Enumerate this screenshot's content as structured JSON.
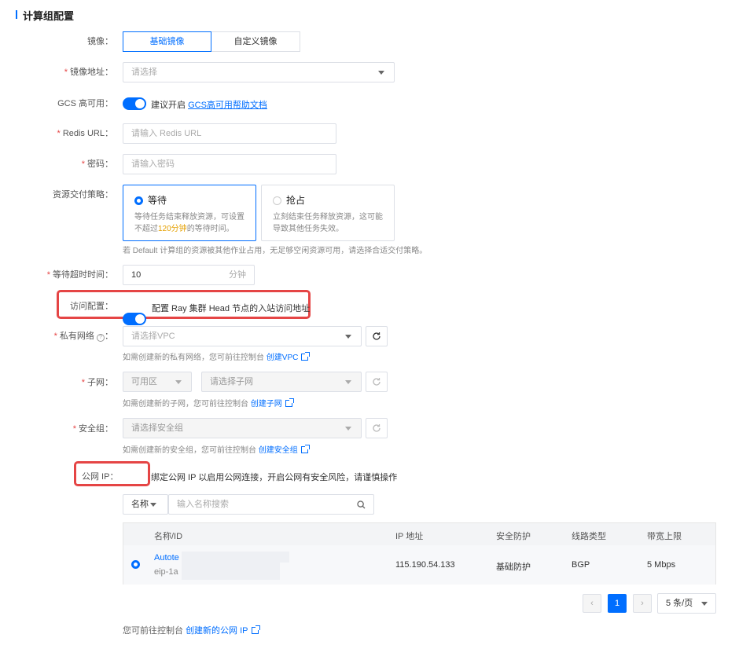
{
  "section_title": "计算组配置",
  "image": {
    "label": "镜像：",
    "options": [
      "基础镜像",
      "自定义镜像"
    ],
    "selected": "基础镜像"
  },
  "image_addr": {
    "label": "镜像地址：",
    "placeholder": "请选择"
  },
  "gcs": {
    "label": "GCS 高可用：",
    "text": "建议开启",
    "link": "GCS高可用帮助文档",
    "enabled": true
  },
  "redis": {
    "label": "Redis URL：",
    "placeholder": "请输入 Redis URL"
  },
  "password": {
    "label": "密码：",
    "placeholder": "请输入密码"
  },
  "strategy": {
    "label": "资源交付策略：",
    "wait": {
      "title": "等待",
      "desc1": "等待任务结束释放资源，可设置",
      "desc2a": "不超过",
      "desc2hl": "120分钟",
      "desc2b": "的等待时间。"
    },
    "preempt": {
      "title": "抢占",
      "desc1": "立刻结束任务释放资源，这可能",
      "desc2": "导致其他任务失效。"
    },
    "selected": "wait",
    "hint": "若 Default 计算组的资源被其他作业占用，无足够空闲资源可用，请选择合适交付策略。"
  },
  "timeout": {
    "label": "等待超时时间：",
    "value": "10",
    "unit": "分钟"
  },
  "access": {
    "label": "访问配置：",
    "text": "配置 Ray 集群 Head 节点的入站访问地址",
    "enabled": true
  },
  "vpc": {
    "label": "私有网络",
    "label_suffix": "：",
    "placeholder": "请选择VPC",
    "hint": "如需创建新的私有网络，您可前往控制台",
    "link": "创建VPC"
  },
  "subnet": {
    "label": "子网：",
    "zone_placeholder": "可用区",
    "placeholder": "请选择子网",
    "hint": "如需创建新的子网，您可前往控制台",
    "link": "创建子网"
  },
  "secgroup": {
    "label": "安全组：",
    "placeholder": "请选择安全组",
    "hint": "如需创建新的安全组，您可前往控制台",
    "link": "创建安全组"
  },
  "public_ip": {
    "label": "公网 IP：",
    "text": "绑定公网 IP 以启用公网连接，开启公网有安全风险，请谨慎操作",
    "enabled": true,
    "filter_label": "名称",
    "search_placeholder": "输入名称搜索",
    "columns": [
      "名称/ID",
      "IP 地址",
      "安全防护",
      "线路类型",
      "带宽上限"
    ],
    "rows": [
      {
        "name": "Autote",
        "id": "eip-1a",
        "ip": "115.190.54.133",
        "protection": "基础防护",
        "line": "BGP",
        "bandwidth": "5 Mbps",
        "selected": true
      }
    ],
    "pager": {
      "prev": "‹",
      "page": "1",
      "next": "›",
      "size": "5 条/页"
    },
    "footer_text": "您可前往控制台",
    "footer_link": "创建新的公网 IP"
  }
}
